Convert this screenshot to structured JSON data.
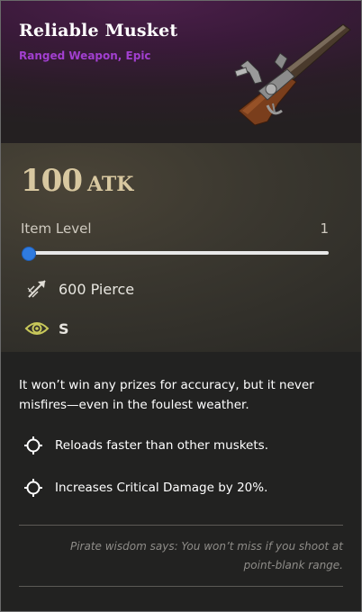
{
  "item": {
    "name": "Reliable Musket",
    "category": "Ranged Weapon, Epic",
    "image_icon": "flintlock-musket-icon"
  },
  "stats": {
    "atk_value": "100",
    "atk_unit": "ATK",
    "item_level_label": "Item Level",
    "item_level_value": "1",
    "item_level_fraction": 0.0,
    "pierce_text": "600 Pierce",
    "pierce_icon": "pierce-arrow-icon",
    "detection_grade": "S",
    "detection_icon": "eye-icon"
  },
  "description": "It won’t win any prizes for accuracy, but it never misfires—even in the foulest weather.",
  "perks": [
    {
      "label": "Reloads faster than other muskets.",
      "icon": "crosshair-icon"
    },
    {
      "label": "Increases Critical Damage by 20%.",
      "icon": "crosshair-icon"
    }
  ],
  "flavor_text": "Pirate wisdom says: You won’t miss if you shoot at point-blank range.",
  "colors": {
    "rarity": "#a23fd0",
    "atk": "#d8c8a0",
    "slider": "#2f7be0",
    "eye": "#c8c85a"
  }
}
